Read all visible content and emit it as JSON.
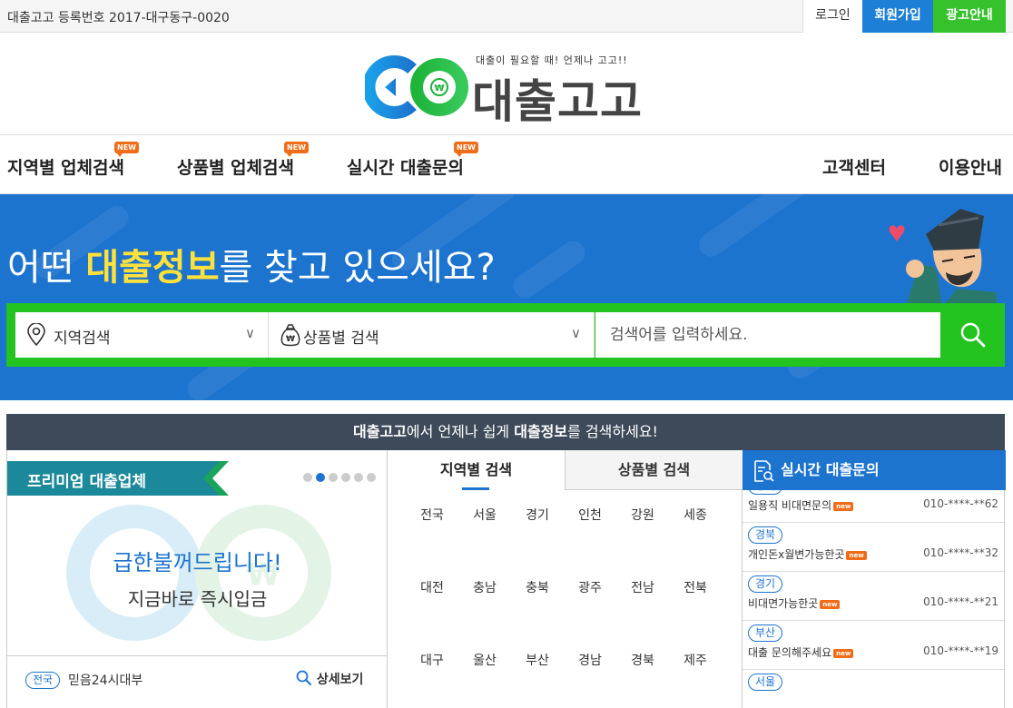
{
  "topbar": {
    "registration": "대출고고 등록번호 2017-대구동구-0020",
    "login": "로그인",
    "join": "회원가입",
    "ad": "광고안내"
  },
  "logo": {
    "tagline": "대출이 필요할 때! 언제나 고고!!",
    "name": "대출고고"
  },
  "nav": {
    "items": [
      {
        "label": "지역별 업체검색",
        "badge": "NEW"
      },
      {
        "label": "상품별 업체검색",
        "badge": "NEW"
      },
      {
        "label": "실시간 대출문의",
        "badge": "NEW"
      }
    ],
    "right": [
      "고객센터",
      "이용안내"
    ]
  },
  "hero": {
    "headline_pre": "어떤 ",
    "headline_hl": "대출정보",
    "headline_post": "를 찾고 있으세요?"
  },
  "search": {
    "region_label": "지역검색",
    "product_label": "상품별 검색",
    "chevron": "∨",
    "placeholder": "검색어를 입력하세요."
  },
  "banner": {
    "b1": "대출고고",
    "t1": "에서 언제나 쉽게 ",
    "b2": "대출정보",
    "t2": "를 검색하세요!"
  },
  "premium": {
    "tag": "프리미엄 대출업체",
    "line1": "급한불꺼드립니다!",
    "line2": "지금바로 즉시입금",
    "region_badge": "전국",
    "company": "믿음24시대부",
    "more": "상세보기",
    "slide_count": 6,
    "active_slide": 2
  },
  "region_tabs": {
    "tab1": "지역별 검색",
    "tab2": "상품별 검색",
    "regions": [
      "전국",
      "서울",
      "경기",
      "인천",
      "강원",
      "세종",
      "대전",
      "충남",
      "충북",
      "광주",
      "전남",
      "전북",
      "대구",
      "울산",
      "부산",
      "경남",
      "경북",
      "제주"
    ]
  },
  "realtime": {
    "title": "실시간 대출문의",
    "new_label": "new",
    "rows": [
      {
        "region": "경기",
        "title": "일용직 비대면문의",
        "phone": "010-****-**62"
      },
      {
        "region": "경북",
        "title": "개인돈x월변가능한곳",
        "phone": "010-****-**32"
      },
      {
        "region": "경기",
        "title": "비대면가능한곳",
        "phone": "010-****-**21"
      },
      {
        "region": "부산",
        "title": "대출 문의해주세요",
        "phone": "010-****-**19"
      },
      {
        "region": "서울",
        "title": "",
        "phone": ""
      }
    ]
  },
  "colors": {
    "brand_blue": "#1d74cf",
    "brand_green": "#23c320",
    "accent_yellow": "#ffe13b",
    "new_orange": "#ef6c18",
    "banner_dark": "#3e4a59"
  },
  "icons": {
    "region_select": "location-pin-icon",
    "product_select": "money-bag-icon",
    "search_button": "magnifier-icon",
    "detail": "magnifier-icon",
    "realtime_head": "document-search-icon"
  }
}
